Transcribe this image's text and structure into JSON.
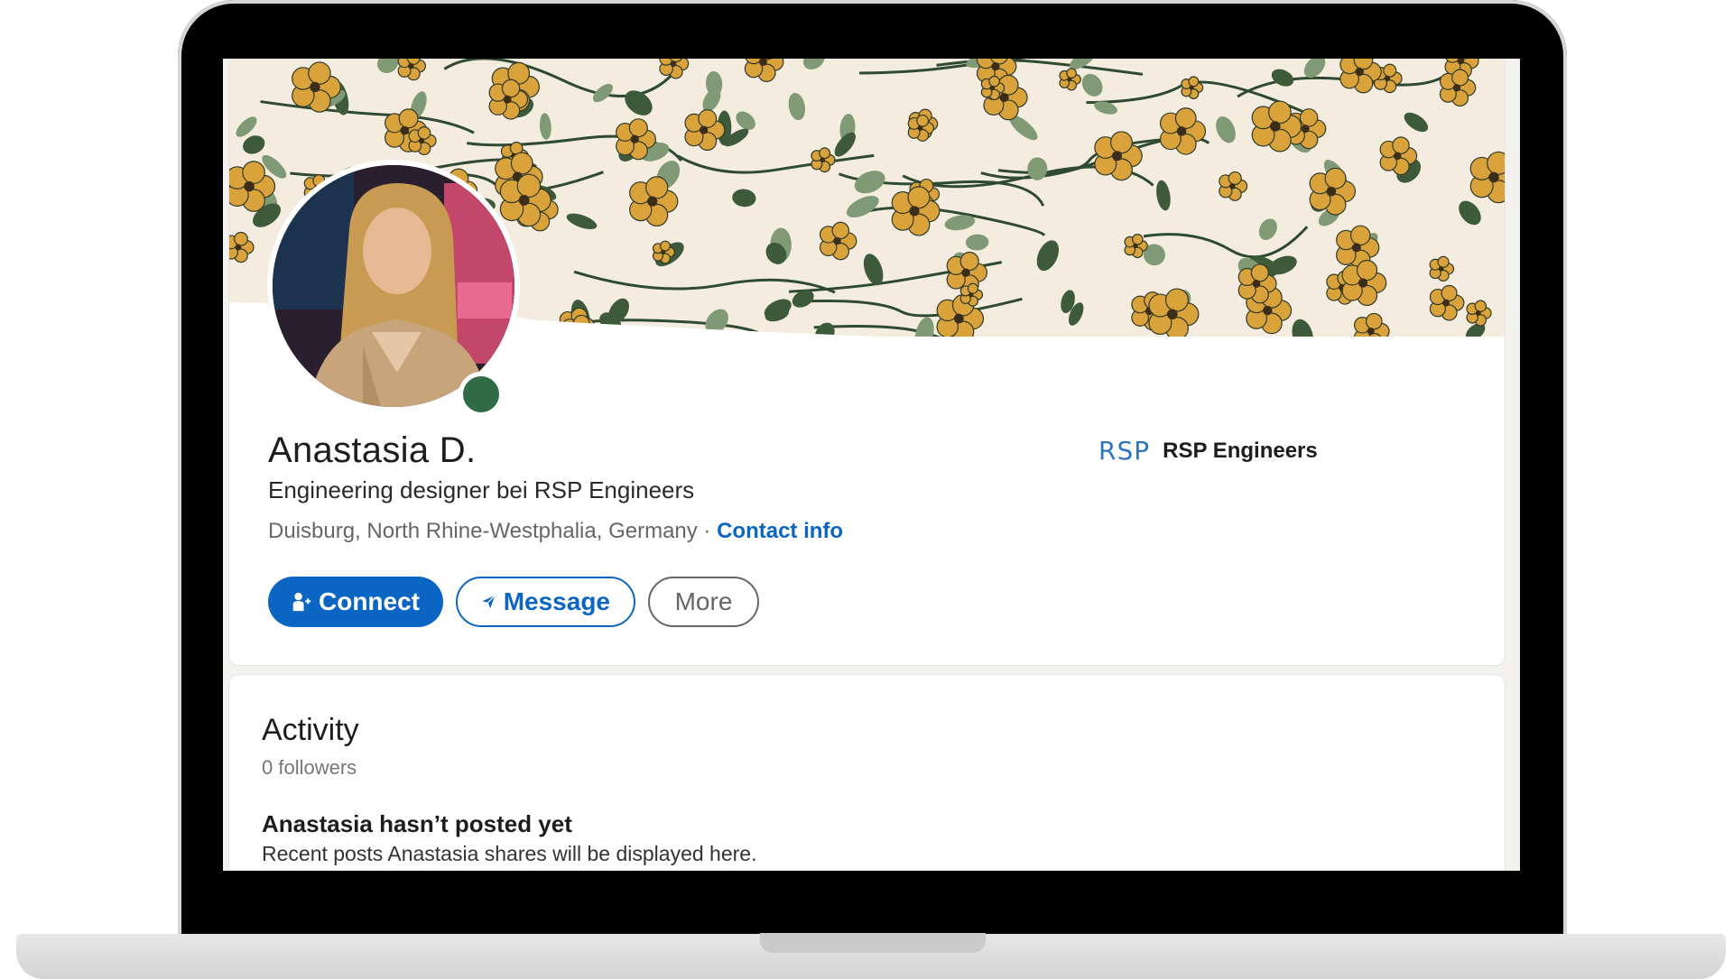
{
  "profile": {
    "name": "Anastasia D.",
    "headline": "Engineering designer bei RSP Engineers",
    "location": "Duisburg, North Rhine-Westphalia, Germany",
    "separator": " · ",
    "contact_link": "Contact info",
    "online_status_color": "#2f6b45",
    "company": {
      "logo_text": "RSP",
      "name": "RSP Engineers"
    },
    "actions": {
      "connect": "Connect",
      "message": "Message",
      "more": "More"
    }
  },
  "activity": {
    "title": "Activity",
    "followers": "0 followers",
    "empty_title": "Anastasia hasn’t posted yet",
    "empty_desc": "Recent posts Anastasia shares will be displayed here."
  },
  "colors": {
    "brand_blue": "#0a66c2",
    "banner_bg": "#f3ecdf",
    "flower_gold": "#d9a23a",
    "leaf_green": "#3d5a3b"
  },
  "icons": {
    "connect": "add-person-icon",
    "message": "paper-plane-icon"
  }
}
